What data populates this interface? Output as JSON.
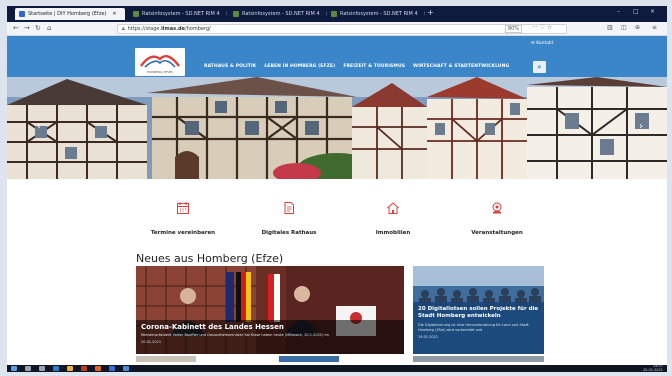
{
  "browser": {
    "tabs": [
      {
        "label": "Startseite | DIY Homberg (Efze)",
        "active": true
      },
      {
        "label": "Ratsinfosystem - SD.NET RIM 4",
        "active": false
      },
      {
        "label": "Ratsinfosystem - SD.NET RIM 4",
        "active": false
      },
      {
        "label": "Ratsinfosystem - SD.NET RIM 4",
        "active": false
      }
    ],
    "new_tab": "+",
    "url_prefix": "https://stage.",
    "url_domain": "ilmas.de",
    "url_path": "/homberg/",
    "zoom": "80%",
    "window_controls": [
      "–",
      "□",
      "×"
    ]
  },
  "site": {
    "logo_text": "HOMBERG (EFZE)",
    "contact": "✉ Kontakt",
    "nav": [
      "RATHAUS & POLITIK",
      "LEBEN IN HOMBERG (EFZE)",
      "FREIZEIT & TOURISMUS",
      "WIRTSCHAFT & STADTENTWICKLUNG"
    ],
    "search_icon": "search-icon"
  },
  "hero": {
    "prev": "‹",
    "next": "›"
  },
  "quick_links": [
    {
      "label": "Termine vereinbaren",
      "icon": "calendar-icon"
    },
    {
      "label": "Digitales Rathaus",
      "icon": "document-icon"
    },
    {
      "label": "Immobilien",
      "icon": "house-icon"
    },
    {
      "label": "Veranstaltungen",
      "icon": "event-icon"
    }
  ],
  "news": {
    "title": "Neues aus Homberg (Efze)",
    "main": {
      "title": "Corona-Kabinett des Landes Hessen",
      "text": "Ministerpräsident Volker Bouffier und Gesundheitsminister Kai Klose haben heute (Mittwoch, 20.1.2021) im",
      "date": "20.01.2021"
    },
    "side": {
      "title": "20 Digitallotsen sollen Projekte für die Stadt Homberg entwickeln",
      "text": "Die Digitalisierung ist eine Herausforderung für Land und Stadt Homberg (Efze) wird vorbereitet und",
      "date": "19.01.2021"
    }
  },
  "taskbar": {
    "time": "14:57",
    "date": "20.01.2021"
  },
  "colors": {
    "brand_blue": "#3a86c9",
    "accent_red": "#d9413a",
    "tab_strip": "#0f1b3e"
  }
}
